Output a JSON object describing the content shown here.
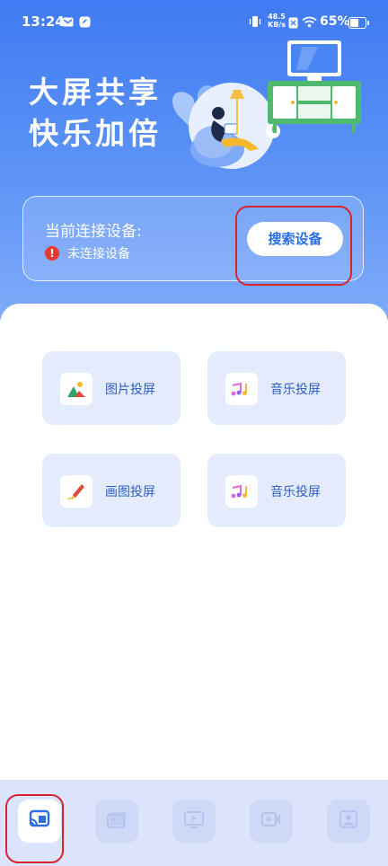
{
  "status_bar": {
    "time": "13:24",
    "net_speed_value": "48.5",
    "net_speed_unit": "KB/s",
    "battery_text": "65%",
    "battery_level": 0.65
  },
  "hero": {
    "slogan_line1": "大屏共享",
    "slogan_line2": "快乐加倍"
  },
  "connection": {
    "title": "当前连接设备:",
    "status_icon": "!",
    "status_text": "未连接设备",
    "search_button": "搜索设备"
  },
  "features": [
    {
      "label": "图片投屏",
      "icon": "image-icon"
    },
    {
      "label": "音乐投屏",
      "icon": "music-icon"
    },
    {
      "label": "画图投屏",
      "icon": "pencil-icon"
    },
    {
      "label": "音乐投屏",
      "icon": "music-icon"
    }
  ],
  "bottom_nav": [
    {
      "icon": "cast-icon",
      "active": true
    },
    {
      "icon": "gallery-icon",
      "active": false
    },
    {
      "icon": "tv-play-icon",
      "active": false
    },
    {
      "icon": "video-icon",
      "active": false
    },
    {
      "icon": "portrait-icon",
      "active": false
    }
  ],
  "colors": {
    "primary": "#3f7bf2",
    "tile_bg": "#e3ebfd",
    "label_blue": "#2f5fc4",
    "warning_red": "#e33b2e",
    "highlight_red": "#d9232e"
  }
}
